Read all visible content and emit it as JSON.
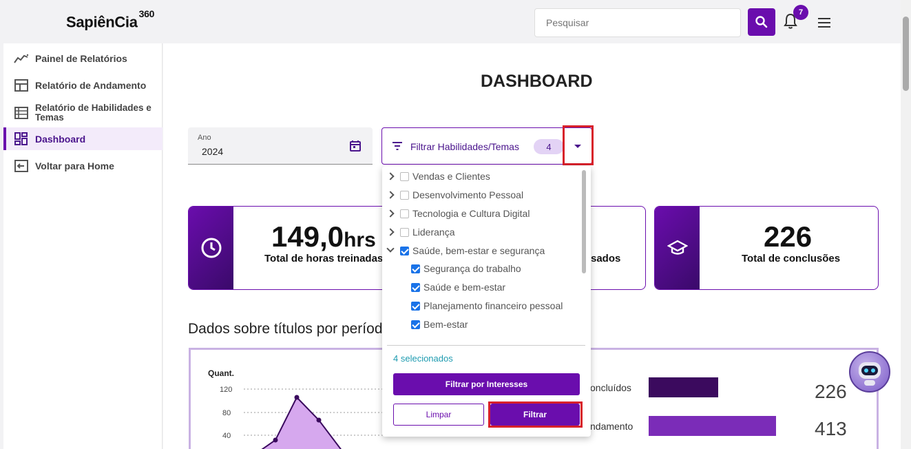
{
  "header": {
    "logo_text": "SapiênCia",
    "logo_suffix": "360",
    "search_placeholder": "Pesquisar",
    "notifications_count": "7"
  },
  "sidebar": {
    "items": [
      {
        "label": "Painel de Relatórios",
        "icon": "trend-icon"
      },
      {
        "label": "Relatório de Andamento",
        "icon": "layout-icon"
      },
      {
        "label": "Relatório de Habilidades e Temas",
        "icon": "table-icon"
      },
      {
        "label": "Dashboard",
        "icon": "dashboard-icon",
        "active": true
      },
      {
        "label": "Voltar para Home",
        "icon": "logout-icon"
      }
    ]
  },
  "page": {
    "title": "DASHBOARD",
    "year_label": "Ano",
    "year_value": "2024",
    "filter_label": "Filtrar Habilidades/Temas",
    "filter_count": "4"
  },
  "cards": [
    {
      "value": "149,0",
      "unit": "hrs",
      "label": "Total de horas treinadas"
    },
    {
      "label_partial": "sados"
    },
    {
      "value": "226",
      "label": "Total de conclusões"
    }
  ],
  "section_title": "Dados sobre títulos por períod",
  "chart": {
    "ylabel": "Quant.",
    "yticks": [
      "120",
      "80",
      "40"
    ],
    "bars": [
      {
        "label": "oncluídos",
        "value": "226",
        "color": "#3b0a5e"
      },
      {
        "label": "ndamento",
        "value": "413",
        "color": "#7b2cb8"
      }
    ]
  },
  "dropdown": {
    "options": [
      {
        "label": "Vendas e Clientes",
        "checked": false,
        "expandable": true
      },
      {
        "label": "Desenvolvimento Pessoal",
        "checked": false,
        "expandable": true
      },
      {
        "label": "Tecnologia e Cultura Digital",
        "checked": false,
        "expandable": true
      },
      {
        "label": "Liderança",
        "checked": false,
        "expandable": true
      },
      {
        "label": "Saúde, bem-estar e segurança",
        "checked": true,
        "expandable": true,
        "expanded": true
      },
      {
        "label": "Segurança do trabalho",
        "checked": true,
        "child": true
      },
      {
        "label": "Saúde e bem-estar",
        "checked": true,
        "child": true
      },
      {
        "label": "Planejamento financeiro pessoal",
        "checked": true,
        "child": true
      },
      {
        "label": "Bem-estar",
        "checked": true,
        "child": true
      }
    ],
    "selected_text": "4 selecionados",
    "interests_button": "Filtrar por Interesses",
    "clear_button": "Limpar",
    "filter_button": "Filtrar"
  },
  "colors": {
    "accent": "#6a0dad",
    "highlight": "#d8202a"
  }
}
